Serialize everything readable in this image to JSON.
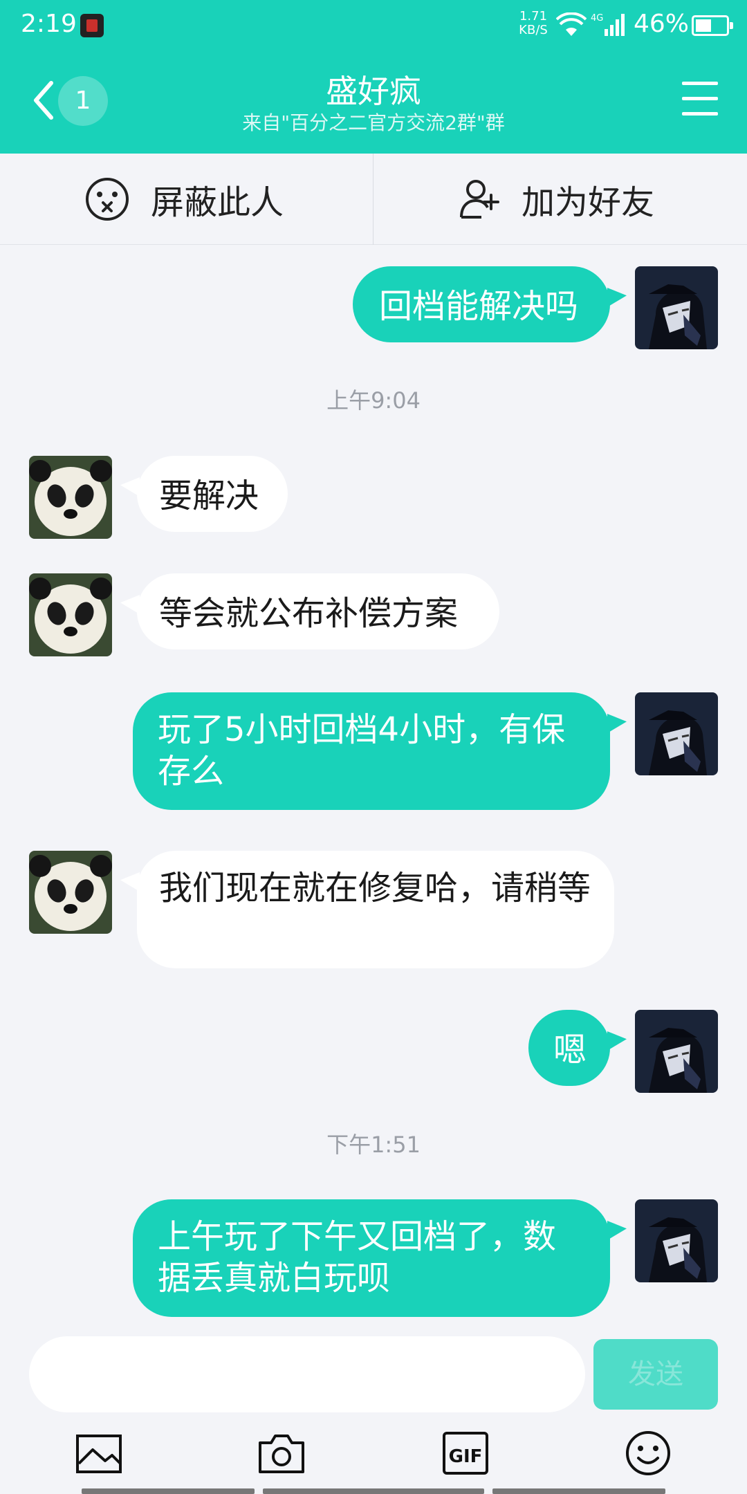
{
  "status_bar": {
    "time": "2:19",
    "speed_value": "1.71",
    "speed_unit": "KB/S",
    "network": "4G",
    "battery": "46%"
  },
  "header": {
    "unread": "1",
    "title": "盛好疯",
    "subtitle": "来自\"百分之二官方交流2群\"群"
  },
  "actions": {
    "block_label": "屏蔽此人",
    "add_friend_label": "加为好友"
  },
  "messages": [
    {
      "side": "out",
      "text": "回档能解决吗"
    },
    {
      "side": "time",
      "text": "上午9:04"
    },
    {
      "side": "in",
      "text": "要解决"
    },
    {
      "side": "in",
      "text": "等会就公布补偿方案"
    },
    {
      "side": "out",
      "text": "玩了5小时回档4小时，有保存么"
    },
    {
      "side": "in",
      "text": "我们现在就在修复哈，请稍等"
    },
    {
      "side": "out",
      "text": "嗯"
    },
    {
      "side": "time",
      "text": "下午1:51"
    },
    {
      "side": "out",
      "text": "上午玩了下午又回档了，数据丢真就白玩呗"
    }
  ],
  "input": {
    "placeholder": "",
    "send_label": "发送"
  },
  "tools": {
    "gif_label": "GIF"
  },
  "colors": {
    "accent": "#19d2b9",
    "background": "#f3f4f8"
  }
}
